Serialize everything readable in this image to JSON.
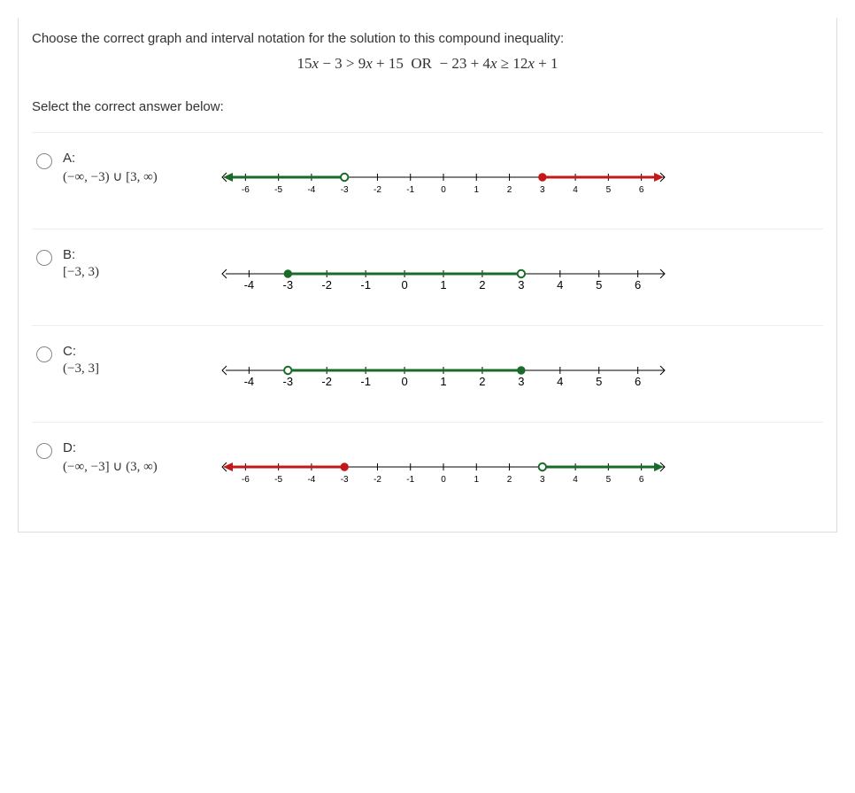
{
  "question": "Choose the correct graph and interval notation for the solution to this compound inequality:",
  "equation": "15x − 3 > 9x + 15 OR − 23 + 4x ≥ 12x + 1",
  "select": "Select the correct answer below:",
  "options": [
    {
      "label": "A:",
      "interval": "(−∞, −3) ∪ [3, ∞)",
      "graph": {
        "min": -6,
        "max": 6,
        "ext": 0.6,
        "segs": [
          {
            "from": "left",
            "to": -3,
            "end": "open",
            "color": "#1a6b2a"
          },
          {
            "from": 3,
            "to": "right",
            "end": "closed",
            "color": "#c21818"
          }
        ],
        "tickFont": 10
      }
    },
    {
      "label": "B:",
      "interval": "[−3, 3)",
      "graph": {
        "min": -4,
        "max": 6,
        "ext": 0.6,
        "segs": [
          {
            "from": -3,
            "to": 3,
            "ends": [
              "closed",
              "open"
            ],
            "color": "#1a6b2a"
          }
        ],
        "tickFont": 13
      }
    },
    {
      "label": "C:",
      "interval": "(−3, 3]",
      "graph": {
        "min": -4,
        "max": 6,
        "ext": 0.6,
        "segs": [
          {
            "from": -3,
            "to": 3,
            "ends": [
              "open",
              "closed"
            ],
            "color": "#1a6b2a"
          }
        ],
        "tickFont": 13
      }
    },
    {
      "label": "D:",
      "interval": "(−∞, −3] ∪ (3, ∞)",
      "graph": {
        "min": -6,
        "max": 6,
        "ext": 0.6,
        "segs": [
          {
            "from": "left",
            "to": -3,
            "end": "closed",
            "color": "#c21818"
          },
          {
            "from": 3,
            "to": "right",
            "end": "open",
            "color": "#1a6b2a"
          }
        ],
        "tickFont": 10
      }
    }
  ],
  "chart_data": [
    {
      "type": "numberline",
      "range": [
        -6,
        6
      ],
      "intervals": [
        {
          "from": "-inf",
          "to": -3,
          "left": "open",
          "right": "open"
        },
        {
          "from": 3,
          "to": "inf",
          "left": "closed",
          "right": "open"
        }
      ]
    },
    {
      "type": "numberline",
      "range": [
        -4,
        6
      ],
      "intervals": [
        {
          "from": -3,
          "to": 3,
          "left": "closed",
          "right": "open"
        }
      ]
    },
    {
      "type": "numberline",
      "range": [
        -4,
        6
      ],
      "intervals": [
        {
          "from": -3,
          "to": 3,
          "left": "open",
          "right": "closed"
        }
      ]
    },
    {
      "type": "numberline",
      "range": [
        -6,
        6
      ],
      "intervals": [
        {
          "from": "-inf",
          "to": -3,
          "left": "open",
          "right": "closed"
        },
        {
          "from": 3,
          "to": "inf",
          "left": "open",
          "right": "open"
        }
      ]
    }
  ]
}
